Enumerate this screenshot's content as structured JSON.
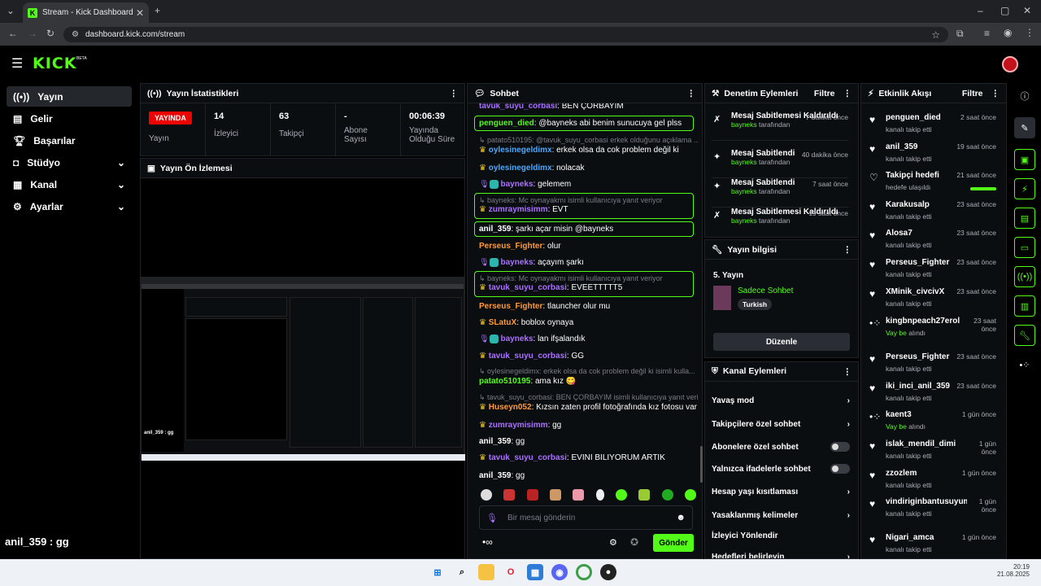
{
  "browser": {
    "tab_title": "Stream - Kick Dashboard",
    "url": "dashboard.kick.com/stream"
  },
  "header": {
    "logo": "KICK",
    "beta": "BETA"
  },
  "sidebar": {
    "items": [
      {
        "label": "Yayın",
        "icon": "broadcast-icon"
      },
      {
        "label": "Gelir",
        "icon": "chart-icon"
      },
      {
        "label": "Başarılar",
        "icon": "trophy-icon"
      },
      {
        "label": "Stüdyo",
        "icon": "studio-icon"
      },
      {
        "label": "Kanal",
        "icon": "channel-icon"
      },
      {
        "label": "Ayarlar",
        "icon": "gear-icon"
      }
    ]
  },
  "stats": {
    "title": "Yayın İstatistikleri",
    "live_badge": "YAYINDA",
    "live_label": "Yayın",
    "items": [
      {
        "value": "14",
        "label": "İzleyici"
      },
      {
        "value": "63",
        "label": "Takipçi"
      },
      {
        "value": "-",
        "label": "Abone Sayısı"
      },
      {
        "value": "00:06:39",
        "label": "Yayında Olduğu Süre"
      }
    ]
  },
  "preview": {
    "title": "Yayın Ön İzlemesi",
    "overlay_text": "anil_359 : gg"
  },
  "chat": {
    "title": "Sohbet",
    "placeholder": "Bir mesaj gönderin",
    "send": "Gönder",
    "messages": [
      {
        "user": "tavuk_suyu_corbasi",
        "text": "BEN ÇORBAYIM",
        "color": "#a970ff"
      },
      {
        "user": "penguen_died",
        "text": "@bayneks abi benim sunucuya gel plss",
        "color": "#53fc18"
      },
      {
        "reply": "patato510195: @tavuk_suyu_corbasi erkek olduğunu açıklama ..."
      },
      {
        "user": "oylesinegeldimx",
        "text": "erkek olsa da cok problem değil ki",
        "color": "#4aa8ff"
      },
      {
        "user": "oylesinegeldimx",
        "text": "nolacak",
        "color": "#4aa8ff"
      },
      {
        "user": "bayneks",
        "text": "gelemem",
        "color": "#a970ff"
      },
      {
        "reply": "bayneks: Mc oynayakmı isimli kullanıcıya yanıt veriyor"
      },
      {
        "user": "zumraymisimm",
        "text": "EVT",
        "color": "#a970ff"
      },
      {
        "user": "anil_359",
        "text": "şarkı açar misin @bayneks",
        "color": "#ffffff"
      },
      {
        "user": "Perseus_Fighter",
        "text": "olur",
        "color": "#ff9a3c"
      },
      {
        "user": "bayneks",
        "text": "açayım şarkı",
        "color": "#a970ff"
      },
      {
        "reply": "bayneks: Mc oynayakmı isimli kullanıcıya yanıt veriyor"
      },
      {
        "user": "tavuk_suyu_corbasi",
        "text": "EVEETTTTT5",
        "color": "#a970ff"
      },
      {
        "user": "Perseus_Fighter",
        "text": "tlauncher olur mu",
        "color": "#ff9a3c"
      },
      {
        "user": "SLatuX",
        "text": "boblox oynaya",
        "color": "#ff9a3c"
      },
      {
        "user": "bayneks",
        "text": "lan ifşalandık",
        "color": "#a970ff"
      },
      {
        "user": "tavuk_suyu_corbasi",
        "text": "GG",
        "color": "#a970ff"
      },
      {
        "reply": "oylesinegeldimx: erkek olsa da cok problem değil ki isimli kulla..."
      },
      {
        "user": "patato510195",
        "text": "ama kız 😋",
        "color": "#53fc18"
      },
      {
        "reply": "tavuk_suyu_corbasi: BEN ÇORBAYIM isimli kullanıcıya yanıt veri..."
      },
      {
        "user": "Huseyn052",
        "text": "Kızsın zaten profil fotoğrafında kız fotosu var",
        "color": "#ff9a3c"
      },
      {
        "user": "zumraymisimm",
        "text": "gg",
        "color": "#a970ff"
      },
      {
        "user": "anil_359",
        "text": "gg",
        "color": "#ffffff"
      },
      {
        "user": "tavuk_suyu_corbasi",
        "text": "EVİNİ BİLİYORUM ARTIK",
        "color": "#a970ff"
      },
      {
        "user": "anil_359",
        "text": "gg",
        "color": "#ffffff"
      }
    ]
  },
  "mod": {
    "title": "Denetim Eylemleri",
    "filter": "Filtre",
    "items": [
      {
        "title": "Mesaj Sabitlemesi Kaldırıldı",
        "by": "bayneks",
        "suffix": "tarafından",
        "time": "7 dakika önce"
      },
      {
        "title": "Mesaj Sabitlendi",
        "by": "bayneks",
        "suffix": "tarafından",
        "time": "40 dakika önce"
      },
      {
        "title": "Mesaj Sabitlendi",
        "by": "bayneks",
        "suffix": "tarafından",
        "time": "7 saat önce"
      },
      {
        "title": "Mesaj Sabitlemesi Kaldırıldı",
        "by": "bayneks",
        "suffix": "tarafından",
        "time": "19 saat önce"
      }
    ]
  },
  "stream_info": {
    "title": "Yayın bilgisi",
    "name": "5. Yayın",
    "category": "Sadece Sohbet",
    "tag": "Turkish",
    "edit": "Düzenle"
  },
  "channel_actions": {
    "title": "Kanal Eylemleri",
    "items": [
      {
        "label": "Yavaş mod",
        "type": "arrow"
      },
      {
        "label": "Takipçilere özel sohbet",
        "type": "arrow"
      },
      {
        "label": "Abonelere özel sohbet",
        "type": "toggle"
      },
      {
        "label": "Yalnızca ifadelerle sohbet",
        "type": "toggle"
      },
      {
        "label": "Hesap yaşı kısıtlaması",
        "type": "arrow"
      },
      {
        "label": "Yasaklanmış kelimeler",
        "type": "arrow"
      },
      {
        "label": "İzleyici Yönlendir",
        "type": "none"
      },
      {
        "label": "Hedefleri belirleyin",
        "type": "arrow"
      }
    ]
  },
  "activity": {
    "title": "Etkinlik Akışı",
    "filter": "Filtre",
    "items": [
      {
        "name": "penguen_died",
        "sub": "kanalı takip etti",
        "time": "2 saat önce"
      },
      {
        "name": "anil_359",
        "sub": "kanalı takip etti",
        "time": "19 saat önce"
      },
      {
        "name": "Takipçi hedefi",
        "sub": "hedefe ulaşıldı",
        "time": "21 saat önce",
        "progress": 1
      },
      {
        "name": "Karakusalp",
        "sub": "kanalı takip etti",
        "time": "23 saat önce"
      },
      {
        "name": "Alosa7",
        "sub": "kanalı takip etti",
        "time": "23 saat önce"
      },
      {
        "name": "Perseus_Fighter",
        "sub": "kanalı takip etti",
        "time": "23 saat önce"
      },
      {
        "name": "XMinik_civcivX",
        "sub": "kanalı takip etti",
        "time": "23 saat önce"
      },
      {
        "name": "kingbnpeach27erol",
        "sub_green": "Vay be",
        "sub": "alındı",
        "time": "23 saat önce"
      },
      {
        "name": "Perseus_Fighter",
        "sub": "kanalı takip etti",
        "time": "23 saat önce"
      },
      {
        "name": "iki_inci_anil_359",
        "sub": "kanalı takip etti",
        "time": "23 saat önce"
      },
      {
        "name": "kaent3",
        "sub_green": "Vay be",
        "sub": "alındı",
        "time": "1 gün önce"
      },
      {
        "name": "islak_mendil_dimi",
        "sub": "kanalı takip etti",
        "time": "1 gün önce"
      },
      {
        "name": "zzozlem",
        "sub": "kanalı takip etti",
        "time": "1 gün önce"
      },
      {
        "name": "vindiriginbantusuyum",
        "sub": "kanalı takip etti",
        "time": "1 gün önce"
      },
      {
        "name": "Nigari_amca",
        "sub": "kanalı takip etti",
        "time": "1 gün önce"
      }
    ]
  },
  "overlay_chat": "anil_359 : gg",
  "taskbar": {
    "time": "20:19",
    "date": "21.08.2025"
  }
}
